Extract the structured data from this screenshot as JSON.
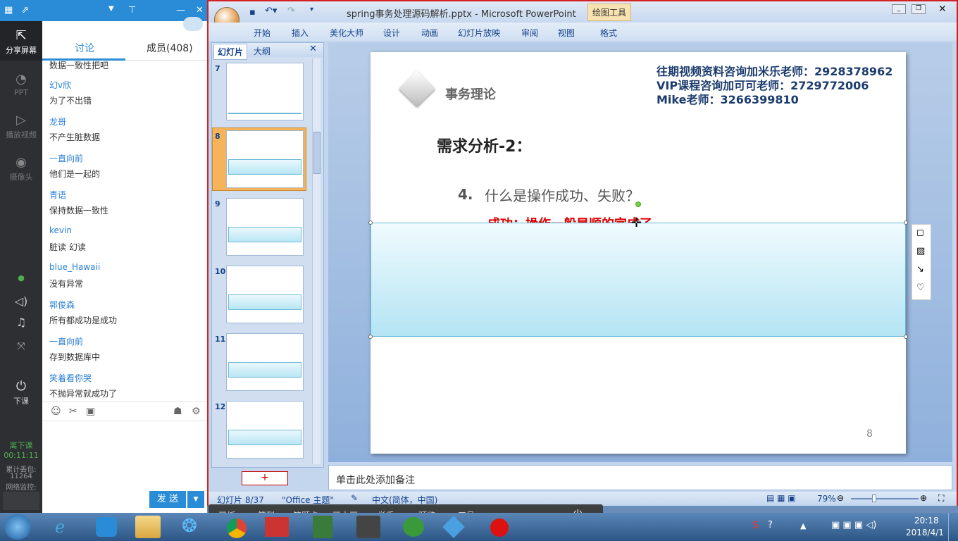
{
  "chat": {
    "tabs": [
      "讨论",
      "成员(408)"
    ],
    "leftbar": {
      "share": "分享屏幕",
      "ppt": "PPT",
      "video": "播放视频",
      "camera": "摄像头",
      "endclass": "下课",
      "status": "离下课",
      "timer": "00:11:11",
      "stat1": "累计丢包:",
      "stat2": "11264",
      "stat3": "网络监控:"
    },
    "partial_top": "数据一致性把吧",
    "messages": [
      {
        "name": "幻v欣",
        "text": "为了不出错"
      },
      {
        "name": "龙哥",
        "text": "不产生脏数据"
      },
      {
        "name": "一直向前",
        "text": "他们是一起的"
      },
      {
        "name": "青语",
        "text": "保持数据一致性"
      },
      {
        "name": "kevin",
        "text": "脏读 幻读"
      },
      {
        "name": "blue_Hawaii",
        "text": "没有异常"
      },
      {
        "name": "郭俊森",
        "text": "所有都成功是成功"
      },
      {
        "name": "一直向前",
        "text": "存到数据库中"
      },
      {
        "name": "笑着看你哭",
        "text": "不抛异常就成功了"
      }
    ],
    "send": "发 送"
  },
  "ppt": {
    "title": "spring事务处理源码解析.pptx - Microsoft PowerPoint",
    "context_tab": "绘图工具",
    "ribbon_tabs": [
      "开始",
      "插入",
      "美化大师",
      "设计",
      "动画",
      "幻灯片放映",
      "审阅",
      "视图",
      "格式"
    ],
    "pane_tabs": [
      "幻灯片",
      "大纲"
    ],
    "thumb_numbers": [
      "7",
      "8",
      "9",
      "10",
      "11",
      "12"
    ],
    "add_slide": "+",
    "slide": {
      "logo_text": "事务理论",
      "contact1": "往期视频资料咨询加米乐老师：2928378962",
      "contact2": "VIP课程咨询加可可老师：2729772006",
      "contact3": "Mike老师：3266399810",
      "heading": "需求分析-2：",
      "item_num": "4.",
      "item_text": "什么是操作成功、失败？",
      "red_text": "成功：操作一般是顺的完成了",
      "page_num": "8"
    },
    "notes": "单击此处添加备注",
    "status": {
      "slide": "幻灯片 8/37",
      "theme": "\"Office 主题\"",
      "lang": "中文(简体，中国)",
      "zoom": "79%"
    }
  },
  "classbar": [
    "画板",
    "签到",
    "答题卡",
    "画中画",
    "举手",
    "预览",
    "工具"
  ],
  "taskbar": {
    "time": "20:18",
    "date": "2018/4/1"
  }
}
